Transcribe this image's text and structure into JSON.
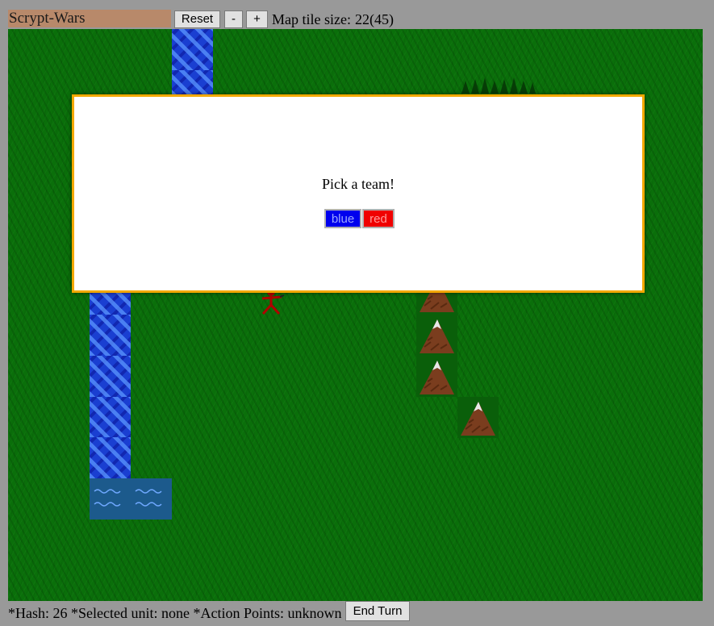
{
  "header": {
    "game_name": "Scrypt-Wars",
    "reset_label": "Reset",
    "zoom_out_label": "-",
    "zoom_in_label": "+",
    "tile_size_label": "Map tile size:",
    "tile_size_value": "22(45)"
  },
  "dialog": {
    "message": "Pick a team!",
    "teams": [
      {
        "label": "blue",
        "color": "#0000ee"
      },
      {
        "label": "red",
        "color": "#f00000"
      }
    ]
  },
  "status": {
    "hash": "*Hash: 26",
    "selected_unit": "*Selected unit: none",
    "action_points": "*Action Points: unknown",
    "end_turn_label": "End Turn"
  },
  "map": {
    "terrain_types": [
      "grass",
      "river",
      "water",
      "mountain",
      "forest"
    ],
    "units": [
      {
        "icon": "soldier-icon",
        "team_color": "#b00000"
      }
    ]
  }
}
